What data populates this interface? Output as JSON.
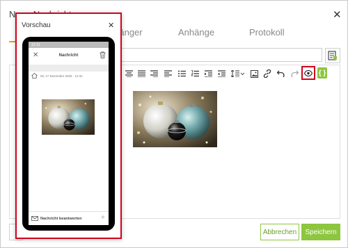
{
  "dialog": {
    "title": "Neue Nachricht",
    "close_symbol": "✕",
    "tabs": [
      {
        "label": "Empfänger"
      },
      {
        "label": "Anhänge"
      },
      {
        "label": "Protokoll"
      }
    ],
    "buttons": {
      "cancel": "Abbrechen",
      "save": "Speichern"
    },
    "braces_symbol": "{ }"
  },
  "preview": {
    "title": "Vorschau",
    "close_symbol": "✕",
    "phone": {
      "status_time": "12:31",
      "app_title": "Nachricht",
      "close_symbol": "✕",
      "message_date": "Mi, 17 Dezember 2025 · 12:31",
      "reply_label": "Nachricht beantworten",
      "plus_symbol": "+"
    }
  },
  "colors": {
    "accent": "#8dc63f",
    "highlight": "#d0021b",
    "tab_underline": "#e8a300"
  },
  "icons": [
    "eye-icon",
    "link-icon",
    "image-icon",
    "undo-icon",
    "redo-icon",
    "trash-icon",
    "home-icon",
    "mail-icon",
    "template-icon"
  ]
}
